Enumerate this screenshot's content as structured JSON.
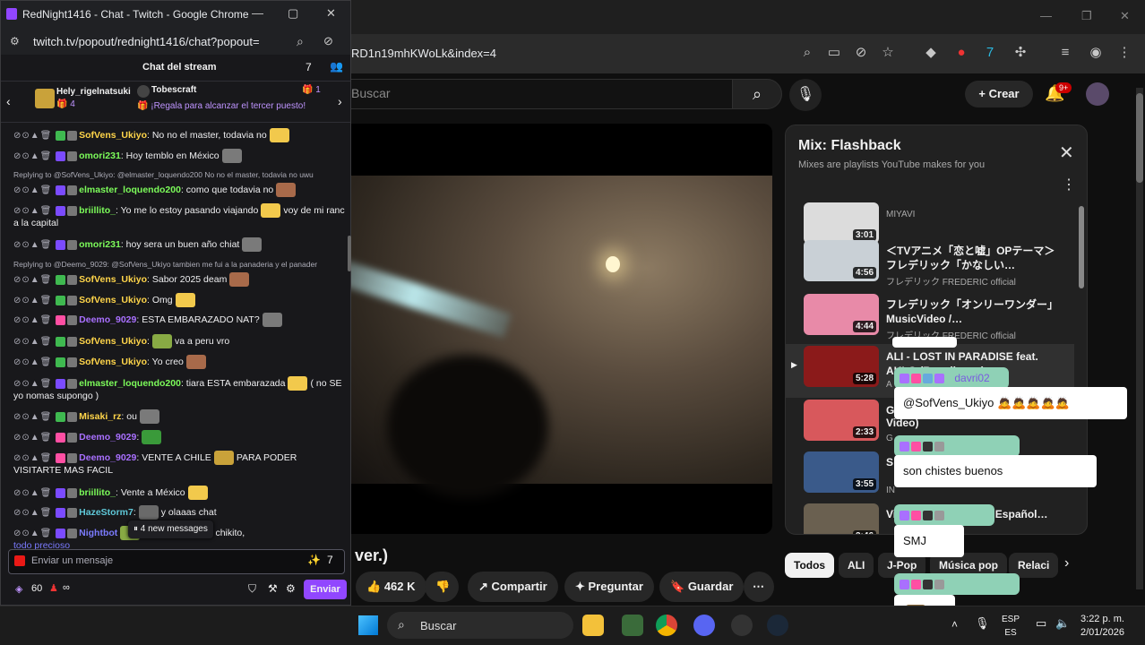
{
  "youtube_window": {
    "url_fragment": "RD1n19mhKWoLk&index=4",
    "search_placeholder": "Buscar",
    "create_label": "Crear",
    "notification_badge": "9+",
    "video_title_fragment": "ver.)",
    "actions": {
      "like_count": "462 K",
      "share": "Compartir",
      "ask": "Preguntar",
      "save": "Guardar"
    },
    "chips": [
      "Todos",
      "ALI",
      "J-Pop",
      "Música pop",
      "Relaci"
    ],
    "mix": {
      "title": "Mix: Flashback",
      "subtitle": "Mixes are playlists YouTube makes for you",
      "items": [
        {
          "title": "",
          "channel": "MIYAVI",
          "duration": "3:01",
          "color": "#dcdcdc"
        },
        {
          "title": "＜TVアニメ「恋と嘘」OPテーマ＞フレデリック「かなしい…",
          "channel": "フレデリック FREDERIC official",
          "duration": "4:56",
          "color": "#c9d0d6"
        },
        {
          "title": "フレデリック「オンリーワンダー」MusicVideo /…",
          "channel": "フレデリック FREDERIC official",
          "duration": "4:44",
          "color": "#e88aa8"
        },
        {
          "title": "ALI - LOST IN PARADISE feat. AKLO (Re-edit ver.)",
          "channel": "A",
          "duration": "5:28",
          "color": "#8b1a1a"
        },
        {
          "title": "G",
          "channel": "G",
          "duration": "2:33",
          "color": "#d8585c",
          "extra": "Video)"
        },
        {
          "title": "S",
          "channel": "IN",
          "duration": "3:55",
          "color": "#3a5a8a"
        },
        {
          "title": "Videokids - Pai (Pub. Español…",
          "channel": "",
          "duration": "3:46",
          "color": "#6a6050"
        }
      ]
    }
  },
  "overlay": {
    "messages": [
      {
        "user": "davri02",
        "text": "@SofVens_Ukiyo"
      },
      {
        "user": "",
        "text": "son chistes buenos"
      },
      {
        "user": "",
        "text": "SMJ"
      },
      {
        "user": "",
        "text": ""
      }
    ]
  },
  "chat_window": {
    "title": "RedNight1416 - Chat - Twitch - Google Chrome",
    "url": "twitch.tv/popout/rednight1416/chat?popout=",
    "header": "Chat del stream",
    "gift": {
      "user1": "Hely_rigelnatsuki",
      "count1": "4",
      "user2": "Tobescraft",
      "count2": "1",
      "cta": "¡Regala para alcanzar el tercer puesto!"
    },
    "messages": [
      {
        "user": "SofVens_Ukiyo",
        "color": "#ffd54a",
        "text": ": No no el master, todavia no"
      },
      {
        "user": "omori231",
        "color": "#7cfc5a",
        "text": ": Hoy temblo en México"
      },
      {
        "reply": "Replying to @SofVens_Ukiyo: @elmaster_loquendo200 No no el master, todavia no uwu"
      },
      {
        "user": "elmaster_loquendo200",
        "color": "#7cfc5a",
        "text": ": como que todavia no"
      },
      {
        "user": "briillito_",
        "color": "#7cfc5a",
        "text": ": Yo me lo estoy pasando viajando",
        "text2": "voy de mi rancho",
        "text3": "a la capital"
      },
      {
        "user": "omori231",
        "color": "#7cfc5a",
        "text": ": hoy sera un buen año chiat"
      },
      {
        "reply": "Replying to @Deemo_9029: @SofVens_Ukiyo tambien me fui a la panaderia y el panader"
      },
      {
        "user": "SofVens_Ukiyo",
        "color": "#ffd54a",
        "text": ": Sabor 2025 deam"
      },
      {
        "user": "SofVens_Ukiyo",
        "color": "#ffd54a",
        "text": ": Omg"
      },
      {
        "user": "Deemo_9029",
        "color": "#a970ff",
        "text": ": ESTA EMBARAZADO NAT?"
      },
      {
        "user": "SofVens_Ukiyo",
        "color": "#ffd54a",
        "text": ":",
        "text2": "va a peru vro"
      },
      {
        "user": "SofVens_Ukiyo",
        "color": "#ffd54a",
        "text": ": Yo creo"
      },
      {
        "user": "elmaster_loquendo200",
        "color": "#7cfc5a",
        "text": ": tiara ESTA embarazada",
        "text2": "( no SE",
        "text3": "yo nomas supongo )"
      },
      {
        "user": "Misaki_rz",
        "color": "#ffd54a",
        "text": ": ou"
      },
      {
        "user": "Deemo_9029",
        "color": "#a970ff",
        "text": ":"
      },
      {
        "user": "Deemo_9029",
        "color": "#a970ff",
        "text": ": VENTE A CHILE",
        "text2": "PARA PODER",
        "text3": "VISITARTE MAS FACIL"
      },
      {
        "user": "briillito_",
        "color": "#7cfc5a",
        "text": ": Vente a México"
      },
      {
        "user": "HazeStorm7",
        "color": "#5fc8d8",
        "text": ":",
        "text2": "y olaaas chat"
      },
      {
        "user": "Nightbot",
        "color": "#7b7bff",
        "text": "",
        "text2": "todo bonito, todo chikito,",
        "text3": "todo precioso"
      }
    ],
    "new_messages": "4 new messages",
    "input_placeholder": "Enviar un mensaje",
    "points": "60",
    "infinity": "∞",
    "send": "Enviar"
  },
  "taskbar": {
    "search": "Buscar",
    "lang1": "ESP",
    "lang2": "ES",
    "time": "3:22 p. m.",
    "date": "2/01/2026"
  }
}
